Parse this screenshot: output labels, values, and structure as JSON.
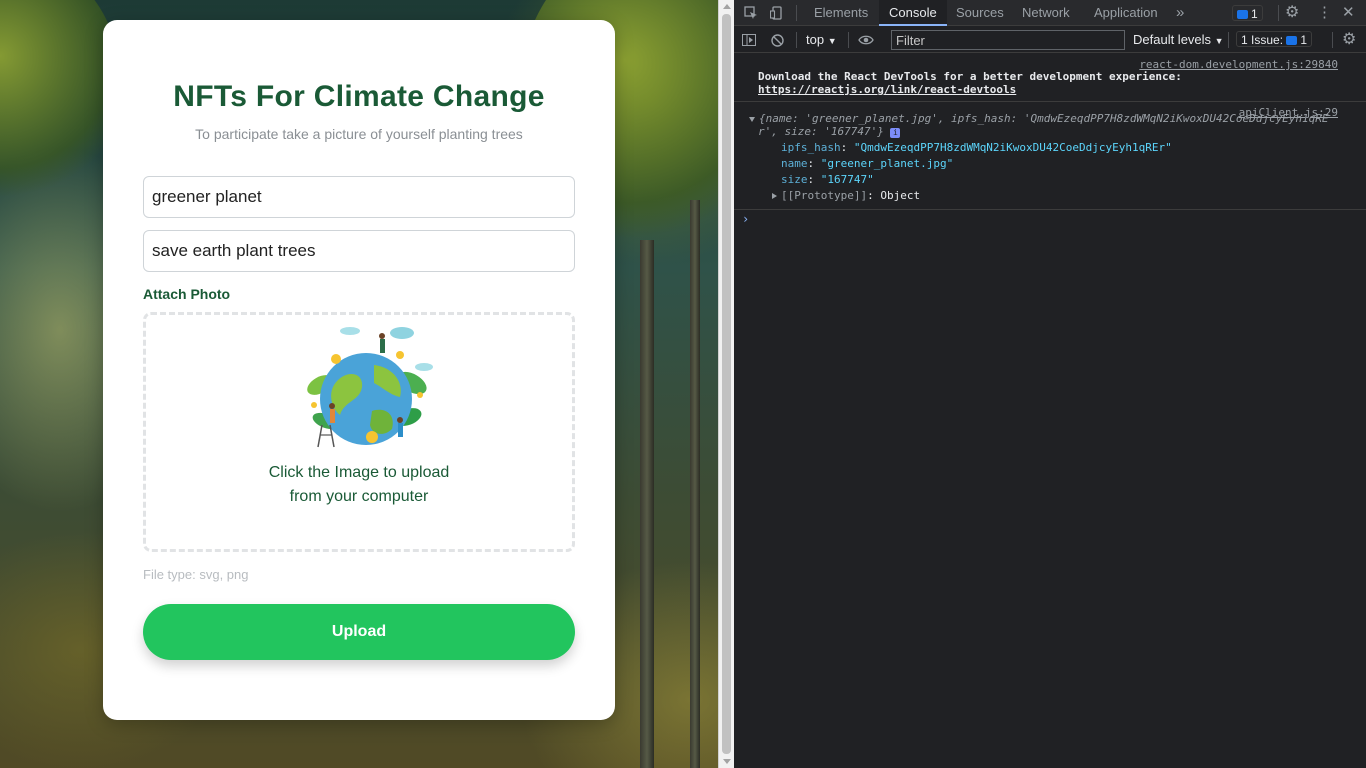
{
  "page": {
    "title": "NFTs For Climate Change",
    "subtitle": "To participate take a picture of yourself planting trees",
    "name_value": "greener planet",
    "description_value": "save earth plant trees",
    "attach_label": "Attach Photo",
    "dropzone_text_line1": "Click the Image to upload",
    "dropzone_text_line2": "from your computer",
    "file_type": "File type: svg, png",
    "upload_label": "Upload"
  },
  "devtools": {
    "tabs": [
      "Elements",
      "Console",
      "Sources",
      "Network",
      "Application"
    ],
    "active_tab": "Console",
    "more_icon": "»",
    "messages_badge_count": "1",
    "context": "top",
    "filter_placeholder": "Filter",
    "levels": "Default levels",
    "issues_label": "1 Issue:",
    "issues_count": "1",
    "console": {
      "msg1_source": "react-dom.development.js:29840",
      "msg1_text": "Download the React DevTools for a better development experience: ",
      "msg1_link": "https://reactjs.org/link/react-devtools",
      "msg2_source": "apiClient.js:29",
      "summary_prefix": "{name: ",
      "summary_name": "'greener_planet.jpg'",
      "summary_mid": ", ipfs_hash: ",
      "summary_hash": "'QmdwEzeqdPP7H8zdWMqN2iKwoxDU42CoeDdjcyEyh1qRE",
      "summary_hash_cont": "r'",
      "summary_size_label": ", size: ",
      "summary_size": "'167747'",
      "summary_end": "}",
      "prop_ipfs_key": "ipfs_hash",
      "prop_ipfs_val": "\"QmdwEzeqdPP7H8zdWMqN2iKwoxDU42CoeDdjcyEyh1qREr\"",
      "prop_name_key": "name",
      "prop_name_val": "\"greener_planet.jpg\"",
      "prop_size_key": "size",
      "prop_size_val": "\"167747\"",
      "prototype_key": "[[Prototype]]",
      "prototype_val": "Object",
      "prompt": "›"
    }
  },
  "colors": {
    "brand_green": "#1a5a36",
    "button_green": "#22c55e",
    "devtools_bg": "#202124"
  }
}
